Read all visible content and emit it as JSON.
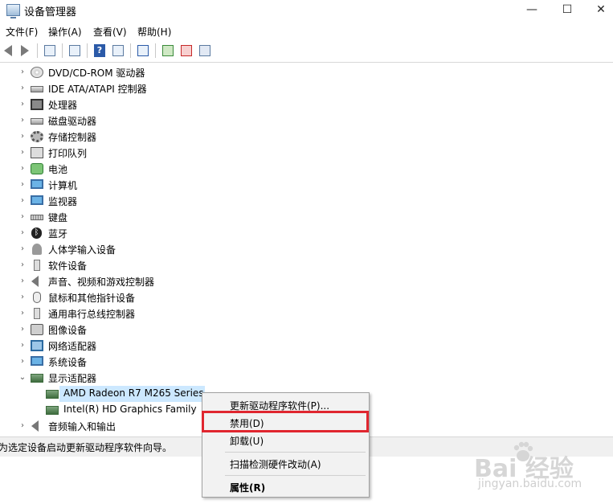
{
  "window": {
    "title": "设备管理器"
  },
  "caption_buttons": {
    "minimize": "—",
    "maximize": "☐",
    "close": "✕"
  },
  "menu": [
    "文件(F)",
    "操作(A)",
    "查看(V)",
    "帮助(H)"
  ],
  "toolbar": {
    "help_glyph": "?"
  },
  "tree": {
    "expand_collapsed": "›",
    "expand_open": "⌄",
    "bt_glyph": "ᛒ",
    "categories": [
      "DVD/CD-ROM 驱动器",
      "IDE ATA/ATAPI 控制器",
      "处理器",
      "磁盘驱动器",
      "存储控制器",
      "打印队列",
      "电池",
      "计算机",
      "监视器",
      "键盘",
      "蓝牙",
      "人体学输入设备",
      "软件设备",
      "声音、视频和游戏控制器",
      "鼠标和其他指针设备",
      "通用串行总线控制器",
      "图像设备",
      "网络适配器",
      "系统设备",
      "显示适配器"
    ],
    "display_children": [
      "AMD Radeon R7 M265 Series",
      "Intel(R) HD Graphics Family"
    ],
    "last_category": "音频输入和输出"
  },
  "status": {
    "text": "为选定设备启动更新驱动程序软件向导。"
  },
  "context_menu": {
    "update": "更新驱动程序软件(P)...",
    "disable": "禁用(D)",
    "uninstall": "卸载(U)",
    "scan": "扫描检测硬件改动(A)",
    "properties": "属性(R)"
  },
  "watermark": {
    "brand": "Bai  经验",
    "url": "jingyan.baidu.com"
  }
}
